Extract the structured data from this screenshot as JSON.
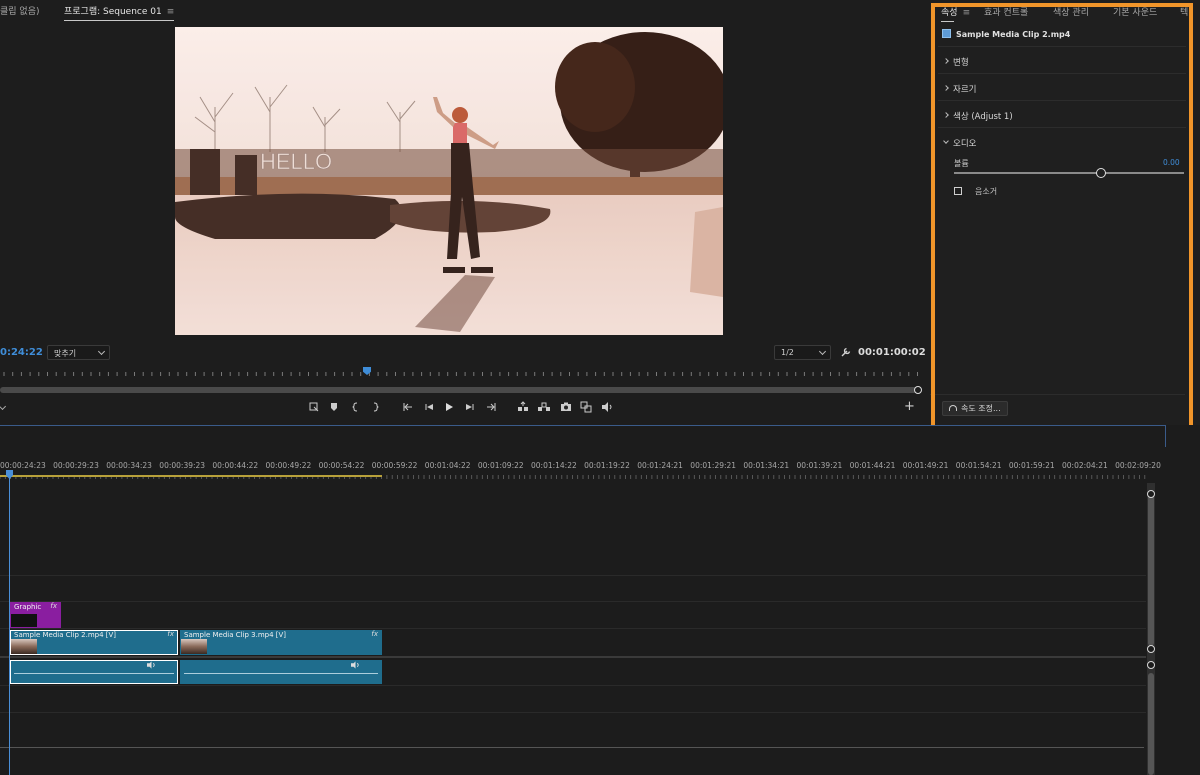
{
  "monitor": {
    "source_tab": "클립 없음)",
    "program_tab": "프로그램: Sequence 01",
    "menu_glyph": "≡",
    "timecode_current": "0:24:22",
    "timecode_duration": "00:01:00:02",
    "fit_label": "맞추기",
    "resolution_label": "1/2",
    "video_overlay_text": "HELLO",
    "transport_icons": [
      "marker-icon",
      "in-point-icon",
      "out-point-icon",
      "go-to-in-icon",
      "step-back-icon",
      "play-icon",
      "step-forward-icon",
      "go-to-out-icon",
      "lift-icon",
      "extract-icon",
      "export-frame-icon",
      "comparison-icon",
      "audio-icon"
    ]
  },
  "properties": {
    "tabs": [
      "속성",
      "효과 컨트롤",
      "색상 관리",
      "기본 사운드",
      "텍"
    ],
    "tab_menu_glyph": "≡",
    "clip_name": "Sample Media Clip 2.mp4",
    "sections": {
      "transform": "변형",
      "crop": "자르기",
      "color": "색상 (Adjust 1)",
      "audio": "오디오"
    },
    "volume_label": "볼륨",
    "volume_value": "0.00",
    "volume_level": 0.64,
    "mute_label": "음소거",
    "speed_button": "속도 조정..."
  },
  "timeline": {
    "ruler_labels": [
      "00:00:24:23",
      "00:00:29:23",
      "00:00:34:23",
      "00:00:39:23",
      "00:00:44:22",
      "00:00:49:22",
      "00:00:54:22",
      "00:00:59:22",
      "00:01:04:22",
      "00:01:09:22",
      "00:01:14:22",
      "00:01:19:22",
      "00:01:24:21",
      "00:01:29:21",
      "00:01:34:21",
      "00:01:39:21",
      "00:01:44:21",
      "00:01:49:21",
      "00:01:54:21",
      "00:01:59:21",
      "00:02:04:21",
      "00:02:09:20"
    ],
    "graphic_clip": "Graphic",
    "graphic_fx": "fx",
    "video_clips": [
      {
        "name": "Sample Media Clip 2.mp4 [V]",
        "fx": "fx",
        "selected": true
      },
      {
        "name": "Sample Media Clip 3.mp4 [V]",
        "fx": "fx",
        "selected": false
      }
    ],
    "audio_clip_icons": [
      "volume-icon",
      "volume-icon"
    ]
  },
  "colors": {
    "highlight": "#f1952a",
    "accent_blue": "#3f8dd8",
    "clip_teal": "#1f6d8d",
    "graphic_purple": "#8a1ea0"
  }
}
